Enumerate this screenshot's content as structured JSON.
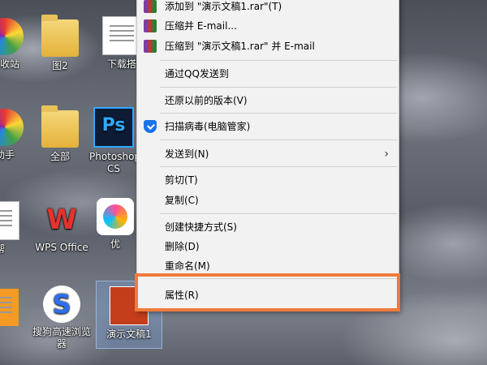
{
  "desktop": {
    "icons": [
      {
        "label": "回收站",
        "kind": "color-circle"
      },
      {
        "label": "图2",
        "kind": "folder"
      },
      {
        "label": "下载搭",
        "kind": "doc"
      },
      {
        "label": "助手",
        "kind": "color-circle"
      },
      {
        "label": "全部",
        "kind": "folder"
      },
      {
        "label": "Photoshop CS",
        "kind": "ps"
      },
      {
        "label": "帮",
        "kind": "doc"
      },
      {
        "label": "WPS Office",
        "kind": "wps"
      },
      {
        "label": "优",
        "kind": "app-pink"
      },
      {
        "label": "",
        "kind": "doc"
      },
      {
        "label": "搜狗高速浏览器",
        "kind": "sogou"
      },
      {
        "label": "演示文稿1",
        "kind": "ppt"
      }
    ]
  },
  "context_menu": {
    "items": [
      {
        "label": "添加到 \"演示文稿1.rar\"(T)",
        "icon": "rar-icon"
      },
      {
        "label": "压缩并 E-mail...",
        "icon": "rar-icon"
      },
      {
        "label": "压缩到 \"演示文稿1.rar\" 并 E-mail",
        "icon": "rar-icon"
      },
      {
        "label": "通过QQ发送到",
        "icon": ""
      },
      {
        "label": "还原以前的版本(V)",
        "icon": ""
      },
      {
        "label": "扫描病毒(电脑管家)",
        "icon": "shield-icon"
      },
      {
        "label": "发送到(N)",
        "icon": "",
        "submenu_arrow": "›"
      },
      {
        "label": "剪切(T)",
        "icon": ""
      },
      {
        "label": "复制(C)",
        "icon": ""
      },
      {
        "label": "创建快捷方式(S)",
        "icon": ""
      },
      {
        "label": "删除(D)",
        "icon": ""
      },
      {
        "label": "重命名(M)",
        "icon": ""
      },
      {
        "label": "属性(R)",
        "icon": ""
      }
    ]
  },
  "highlight_color": "#f07a3c"
}
